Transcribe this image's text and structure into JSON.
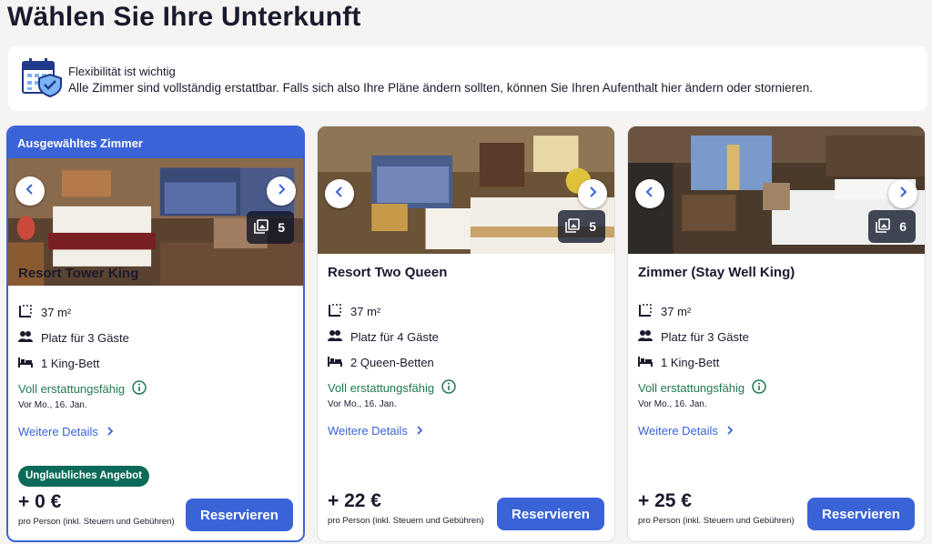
{
  "page_title": "Wählen Sie Ihre Unterkunft",
  "flex_banner": {
    "icon": "calendar-shield-icon",
    "title": "Flexibilität ist wichtig",
    "text": "Alle Zimmer sind vollständig erstattbar. Falls sich also Ihre Pläne ändern sollten, können Sie Ihren Aufenthalt hier ändern oder stornieren."
  },
  "colors": {
    "accent": "#3a63d8",
    "refund_green": "#227950",
    "deal_badge": "#0c6b58"
  },
  "rooms": [
    {
      "selected_label": "Ausgewähltes Zimmer",
      "photo_count": "5",
      "name": "Resort Tower King",
      "size": "37 m²",
      "guests": "Platz für 3 Gäste",
      "beds": "1 King-Bett",
      "refund": "Voll erstattungsfähig",
      "refund_date": "Vor Mo., 16. Jan.",
      "details": "Weitere Details",
      "badge": "Unglaubliches Angebot",
      "price": "+ 0 €",
      "price_note": "pro Person (inkl. Steuern und Gebühren)",
      "reserve": "Reservieren"
    },
    {
      "photo_count": "5",
      "name": "Resort Two Queen",
      "size": "37 m²",
      "guests": "Platz für 4 Gäste",
      "beds": "2 Queen-Betten",
      "refund": "Voll erstattungsfähig",
      "refund_date": "Vor Mo., 16. Jan.",
      "details": "Weitere Details",
      "price": "+ 22 €",
      "price_note": "pro Person (inkl. Steuern und Gebühren)",
      "reserve": "Reservieren"
    },
    {
      "photo_count": "6",
      "name": "Zimmer (Stay Well King)",
      "size": "37 m²",
      "guests": "Platz für 3 Gäste",
      "beds": "1 King-Bett",
      "refund": "Voll erstattungsfähig",
      "refund_date": "Vor Mo., 16. Jan.",
      "details": "Weitere Details",
      "price": "+ 25 €",
      "price_note": "pro Person (inkl. Steuern und Gebühren)",
      "reserve": "Reservieren"
    }
  ]
}
